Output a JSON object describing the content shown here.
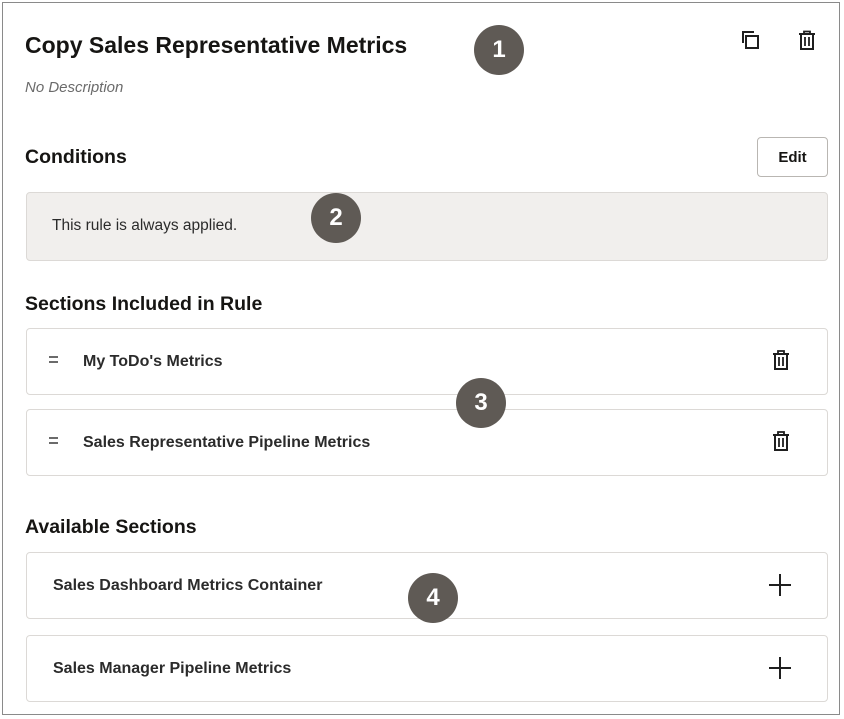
{
  "header": {
    "title": "Copy Sales Representative Metrics",
    "description": "No Description",
    "actions": {
      "duplicate_icon": "copy-icon",
      "delete_icon": "trash-icon"
    }
  },
  "conditions": {
    "heading": "Conditions",
    "edit_label": "Edit",
    "text": "This rule is always applied."
  },
  "included": {
    "heading": "Sections Included in Rule",
    "items": [
      {
        "label": "My ToDo's Metrics",
        "action_icon": "trash-icon"
      },
      {
        "label": "Sales Representative Pipeline Metrics",
        "action_icon": "trash-icon"
      }
    ]
  },
  "available": {
    "heading": "Available Sections",
    "items": [
      {
        "label": "Sales Dashboard Metrics Container",
        "action_icon": "plus-icon"
      },
      {
        "label": "Sales Manager Pipeline Metrics",
        "action_icon": "plus-icon"
      }
    ]
  },
  "callouts": [
    "1",
    "2",
    "3",
    "4"
  ],
  "colors": {
    "callout": "#5f5a55",
    "panel": "#f1efed",
    "border": "#dcd9d6"
  }
}
